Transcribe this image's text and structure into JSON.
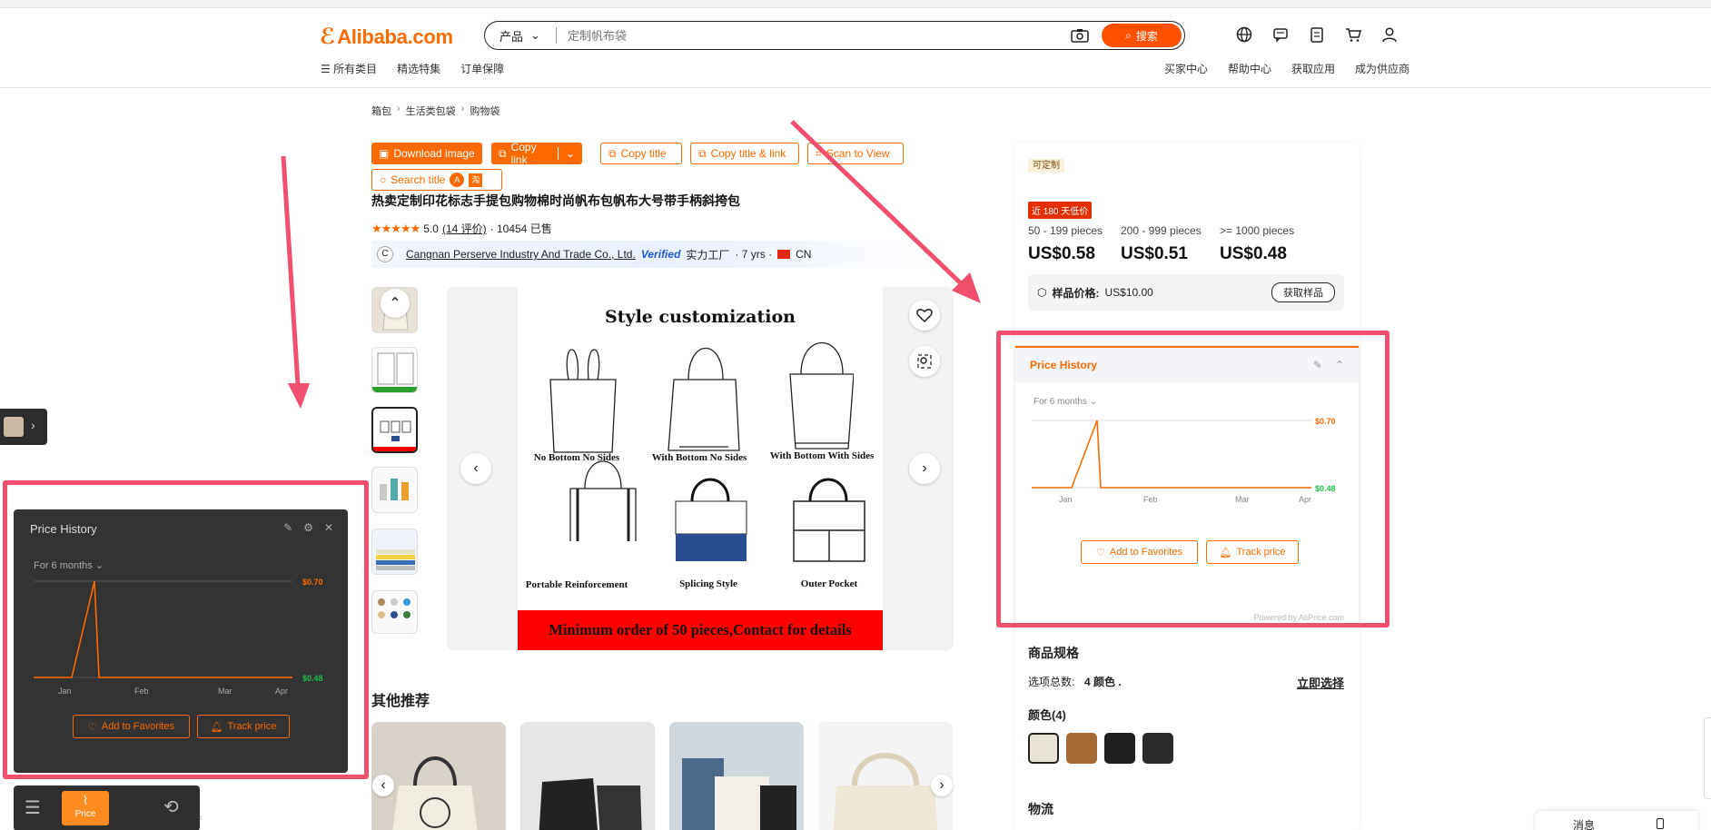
{
  "header": {
    "logo": "Alibaba.com",
    "search_category": "产品",
    "search_placeholder": "定制帆布袋",
    "search_button": "搜索",
    "nav_left": [
      "所有类目",
      "精选特集",
      "订单保障"
    ],
    "nav_right": [
      "买家中心",
      "帮助中心",
      "获取应用",
      "成为供应商"
    ],
    "icons": [
      "globe-icon",
      "message-icon",
      "orders-icon",
      "cart-icon",
      "user-icon"
    ]
  },
  "breadcrumb": [
    "箱包",
    "生活类包袋",
    "购物袋"
  ],
  "toolbar": {
    "download_image": "Download image",
    "copy_link": "Copy link",
    "copy_title": "Copy title",
    "copy_title_link": "Copy title & link",
    "scan_to_view": "Scan to View",
    "search_title": "Search title"
  },
  "product": {
    "title": "热卖定制印花标志手提包购物棉时尚帆布包帆布大号带手柄斜挎包",
    "rating": "5.0",
    "reviews": "(14 评价)",
    "sold": "· 10454 已售",
    "supplier": "Cangnan Perserve Industry And Trade Co., Ltd.",
    "verified": "Verified",
    "factory": "实力工厂",
    "years": "· 7 yrs ·",
    "country": "CN"
  },
  "poster": {
    "title": "Style customization",
    "captions": [
      "No Bottom No Sides",
      "With Bottom No Sides",
      "With Bottom With Sides",
      "Portable Reinforcement",
      "Splicing Style",
      "Outer Pocket"
    ],
    "banner": "Minimum order of 50 pieces,Contact for details"
  },
  "other_recommend": "其他推荐",
  "pricing": {
    "customizable": "可定制",
    "low_badge": "近 180 天低价",
    "tiers": [
      {
        "range": "50 - 199 pieces",
        "price": "US$0.58"
      },
      {
        "range": "200 - 999 pieces",
        "price": "US$0.51"
      },
      {
        "range": ">= 1000 pieces",
        "price": "US$0.48"
      }
    ],
    "sample_label": "样品价格:",
    "sample_price": "US$10.00",
    "sample_button": "获取样品"
  },
  "price_history": {
    "title": "Price History",
    "period": "For 6 months",
    "high": "$0.70",
    "low": "$0.48",
    "months": [
      "Jan",
      "Feb",
      "Mar",
      "Apr"
    ],
    "add_fav": "Add to Favorites",
    "track": "Track price",
    "powered": "Powered by AliPrice.com"
  },
  "specs": {
    "title": "商品规格",
    "options_label": "选项总数:",
    "options_value": "4 颜色 .",
    "select_now": "立即选择",
    "color_label": "颜色(4)",
    "logistics": "物流"
  },
  "chart_data": {
    "type": "line",
    "x": [
      "Jan",
      "Feb",
      "Mar",
      "Apr"
    ],
    "series": [
      {
        "values": [
          0.48,
          0.7,
          0.48,
          0.48
        ]
      }
    ],
    "ylim": [
      0.48,
      0.7
    ]
  },
  "dark_panel": {
    "title": "Price History",
    "period": "For 6 months",
    "high": "$0.70",
    "low": "$0.48",
    "add_fav": "Add to Favorites",
    "track": "Track price"
  },
  "bottom_bar": {
    "price_label": "Price"
  },
  "message": {
    "label": "消息"
  },
  "colors": {
    "accent": "#ff6a00",
    "annotation": "#f0506e",
    "low_price": "#1fbf4b"
  }
}
